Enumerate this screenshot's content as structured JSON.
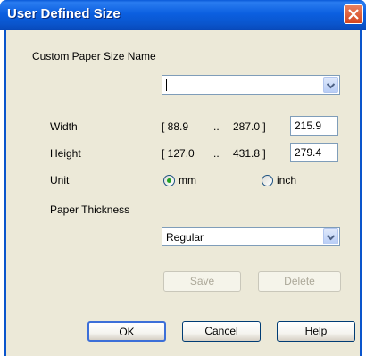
{
  "window": {
    "title": "User Defined Size"
  },
  "custom_name": {
    "label": "Custom Paper Size Name",
    "value": ""
  },
  "width": {
    "label": "Width",
    "range_min": "[ 88.9",
    "range_sep": "..",
    "range_max": "287.0 ]",
    "value": "215.9"
  },
  "height": {
    "label": "Height",
    "range_min": "[ 127.0",
    "range_sep": "..",
    "range_max": "431.8 ]",
    "value": "279.4"
  },
  "unit": {
    "label": "Unit",
    "options": [
      {
        "label": "mm",
        "selected": true
      },
      {
        "label": "inch",
        "selected": false
      }
    ]
  },
  "thickness": {
    "label": "Paper Thickness",
    "value": "Regular"
  },
  "buttons": {
    "save": "Save",
    "delete": "Delete",
    "ok": "OK",
    "cancel": "Cancel",
    "help": "Help"
  },
  "colors": {
    "titlebar": "#0a55cc",
    "client": "#ece9d8",
    "radio_dot": "#21a121"
  }
}
